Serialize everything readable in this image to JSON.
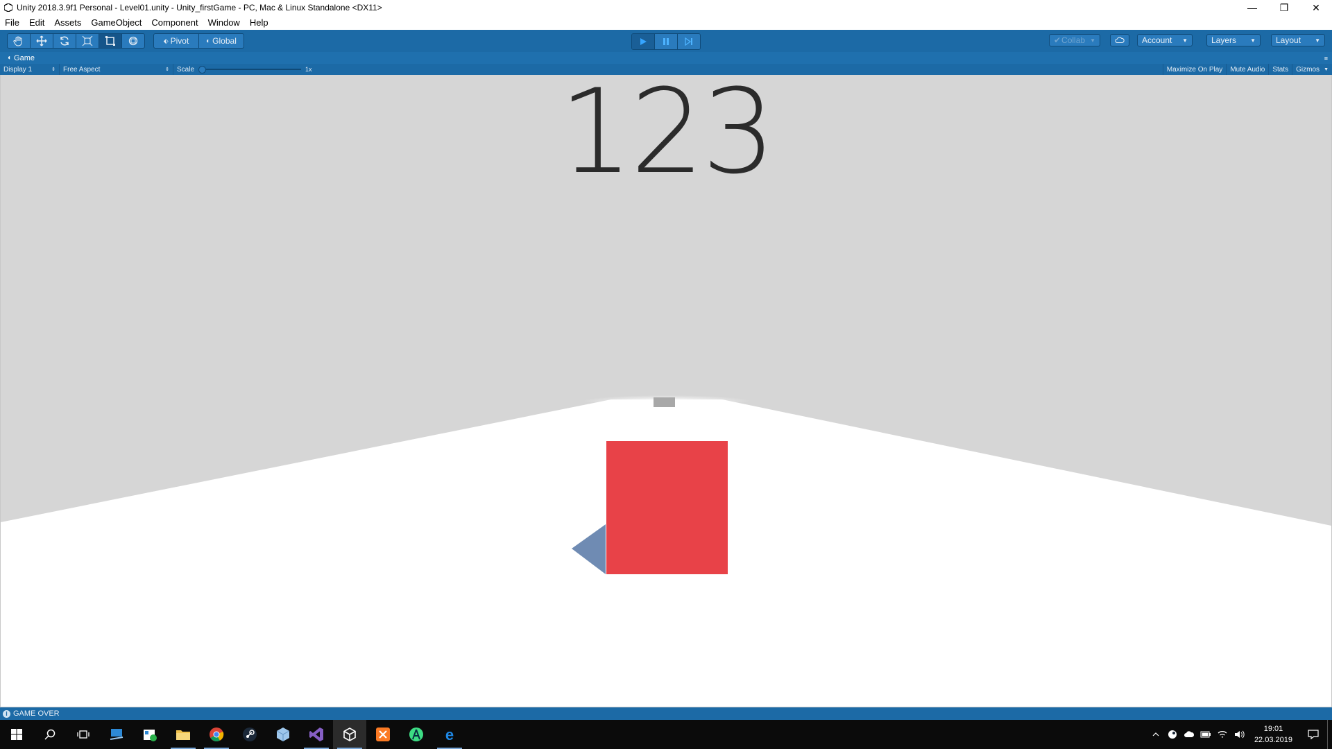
{
  "window": {
    "title": "Unity 2018.3.9f1 Personal - Level01.unity - Unity_firstGame - PC, Mac & Linux Standalone <DX11>",
    "minimize": "—",
    "maximize": "❐",
    "close": "✕"
  },
  "menu": [
    "File",
    "Edit",
    "Assets",
    "GameObject",
    "Component",
    "Window",
    "Help"
  ],
  "toolbar": {
    "pivot": "Pivot",
    "global": "Global",
    "collab": "Collab",
    "account": "Account",
    "layers": "Layers",
    "layout": "Layout"
  },
  "game_tab": {
    "label": "Game",
    "display": "Display 1",
    "aspect": "Free Aspect",
    "scale_label": "Scale",
    "scale_value": "1x",
    "maximize_on_play": "Maximize On Play",
    "mute_audio": "Mute Audio",
    "stats": "Stats",
    "gizmos": "Gizmos"
  },
  "game_view": {
    "score": "123",
    "player_color": "#e84248",
    "obstacle_color": "#a8a8a8",
    "sky_color": "#d6d6d6",
    "ground_color": "#ffffff"
  },
  "status_bar": {
    "message": "GAME OVER"
  },
  "taskbar": {
    "time": "19:01",
    "date": "22.03.2019",
    "apps": [
      "start-icon",
      "search-icon",
      "task-view-icon",
      "remote-app-icon",
      "store-app-icon",
      "file-explorer-icon",
      "chrome-icon",
      "steam-icon",
      "box-app-icon",
      "visual-studio-icon",
      "unity-icon",
      "xampp-icon",
      "android-studio-icon",
      "edge-icon"
    ]
  },
  "colors": {
    "toolbar_blue": "#1c6aa6",
    "play_active": "#36a5ff"
  }
}
